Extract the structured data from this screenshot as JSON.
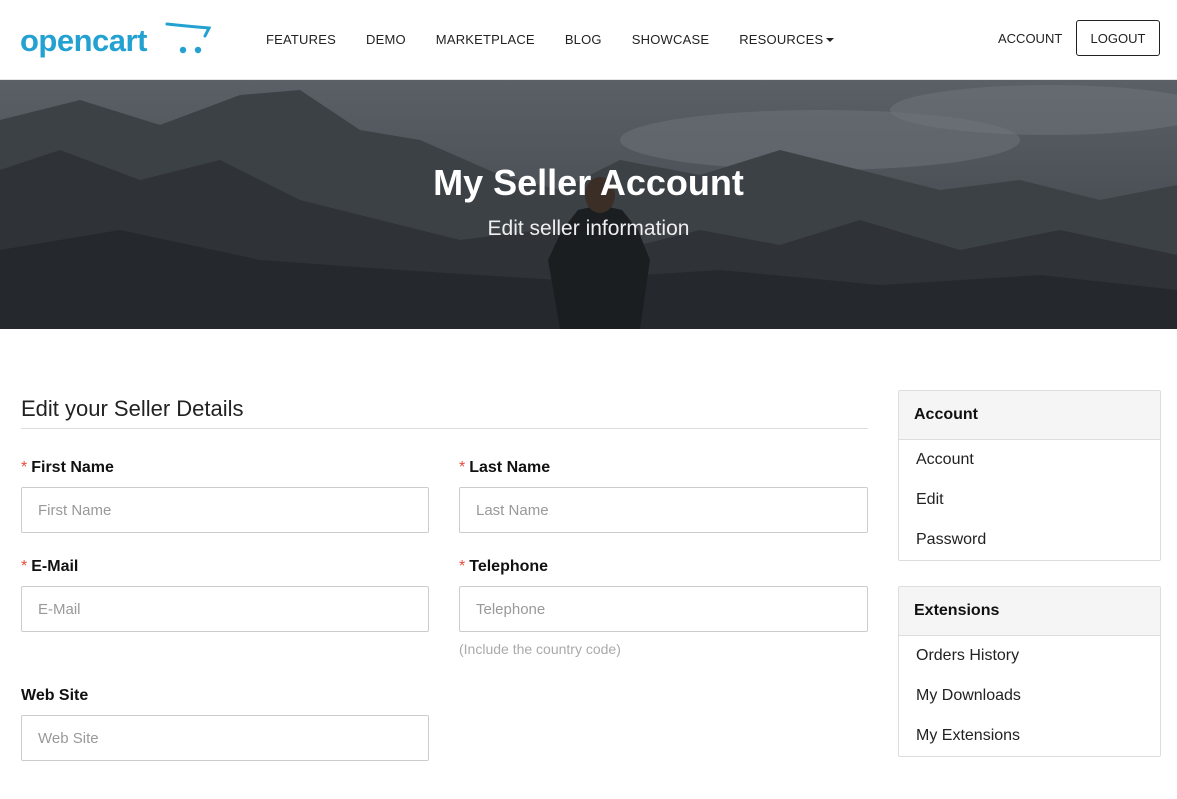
{
  "brand": {
    "name": "opencart",
    "accent": "#23a1d1"
  },
  "nav": {
    "items": [
      {
        "label": "FEATURES"
      },
      {
        "label": "DEMO"
      },
      {
        "label": "MARKETPLACE"
      },
      {
        "label": "BLOG"
      },
      {
        "label": "SHOWCASE"
      },
      {
        "label": "RESOURCES"
      }
    ],
    "account": "ACCOUNT",
    "logout": "LOGOUT"
  },
  "hero": {
    "title": "My Seller Account",
    "subtitle": "Edit seller information"
  },
  "form": {
    "title": "Edit your Seller Details",
    "required_marker": "*",
    "first_name": {
      "label": "First Name",
      "placeholder": "First Name",
      "value": ""
    },
    "last_name": {
      "label": "Last Name",
      "placeholder": "Last Name",
      "value": ""
    },
    "email": {
      "label": "E-Mail",
      "placeholder": "E-Mail",
      "value": ""
    },
    "telephone": {
      "label": "Telephone",
      "placeholder": "Telephone",
      "value": "",
      "help": "(Include the country code)"
    },
    "website": {
      "label": "Web Site",
      "placeholder": "Web Site",
      "value": ""
    }
  },
  "sidebar": {
    "account_panel": {
      "title": "Account",
      "items": [
        {
          "label": "Account"
        },
        {
          "label": "Edit"
        },
        {
          "label": "Password"
        }
      ]
    },
    "extensions_panel": {
      "title": "Extensions",
      "items": [
        {
          "label": "Orders History"
        },
        {
          "label": "My Downloads"
        },
        {
          "label": "My Extensions"
        }
      ]
    }
  },
  "icons": {
    "logo_cart": "cart-icon",
    "dropdown": "caret-down-icon"
  }
}
